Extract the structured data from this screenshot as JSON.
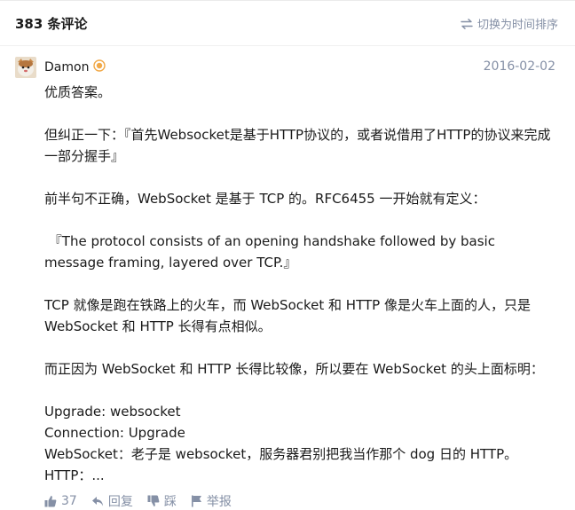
{
  "header": {
    "count_label": "383 条评论",
    "sort_label": "切换为时间排序"
  },
  "comment": {
    "author": "Damon",
    "date": "2016-02-02",
    "lines": [
      "优质答案。",
      "",
      "但纠正一下：『首先Websocket是基于HTTP协议的，或者说借用了HTTP的协议来完成一部分握手』",
      "",
      "前半句不正确，WebSocket 是基于 TCP 的。RFC6455 一开始就有定义：",
      "",
      " 『The protocol consists of an opening handshake followed by basic message framing, layered over TCP.』",
      "",
      "TCP 就像是跑在铁路上的火车，而 WebSocket 和 HTTP 像是火车上面的人，只是 WebSocket 和 HTTP 长得有点相似。",
      "",
      "而正因为 WebSocket 和 HTTP 长得比较像，所以要在 WebSocket 的头上面标明：",
      "",
      "Upgrade: websocket",
      "Connection: Upgrade",
      "WebSocket：老子是 websocket，服务器君别把我当作那个 dog 日的 HTTP。",
      "HTTP：..."
    ]
  },
  "actions": {
    "like_count": "37",
    "reply_label": "回复",
    "dislike_label": "踩",
    "report_label": "举报"
  },
  "icons": {
    "sort": "switch-icon",
    "badge": "medal-icon",
    "like": "thumbs-up-icon",
    "reply": "reply-icon",
    "dislike": "thumbs-down-icon",
    "report": "flag-icon"
  },
  "colors": {
    "muted": "#8590a6",
    "text": "#1a1a1a",
    "badge": "#f1a948"
  }
}
